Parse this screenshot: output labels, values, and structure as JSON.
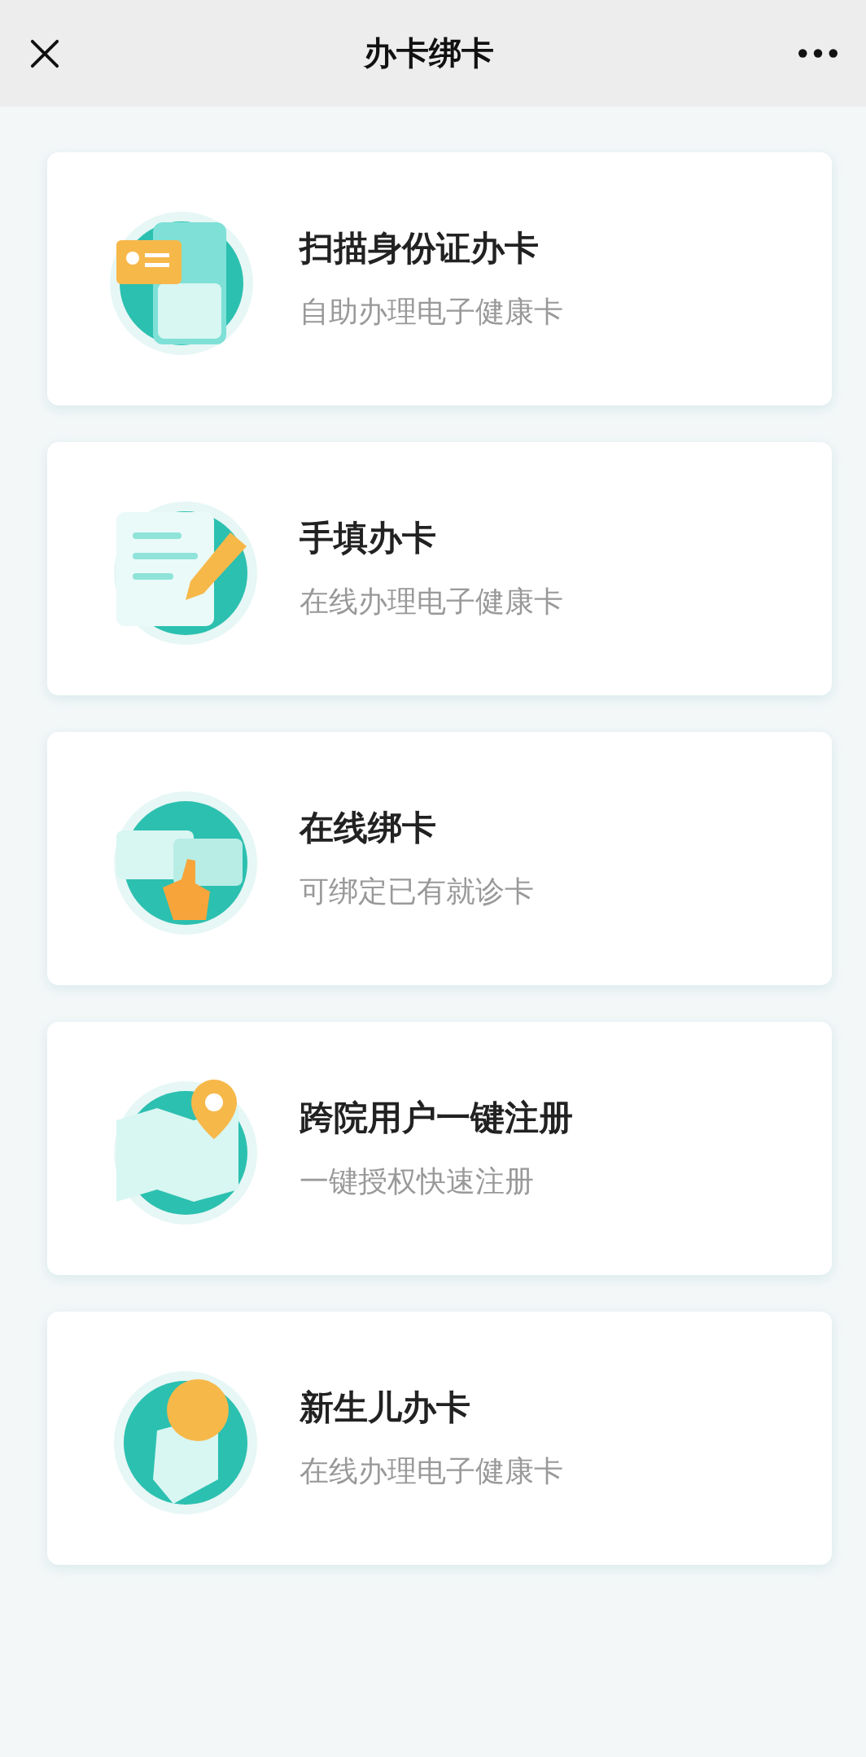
{
  "header": {
    "title": "办卡绑卡"
  },
  "options": [
    {
      "kind": "scan",
      "title": "扫描身份证办卡",
      "subtitle": "自助办理电子健康卡"
    },
    {
      "kind": "form",
      "title": "手填办卡",
      "subtitle": "在线办理电子健康卡"
    },
    {
      "kind": "bind",
      "title": "在线绑卡",
      "subtitle": "可绑定已有就诊卡"
    },
    {
      "kind": "map",
      "title": "跨院用户一键注册",
      "subtitle": "一键授权快速注册"
    },
    {
      "kind": "baby",
      "title": "新生儿办卡",
      "subtitle": "在线办理电子健康卡"
    }
  ]
}
